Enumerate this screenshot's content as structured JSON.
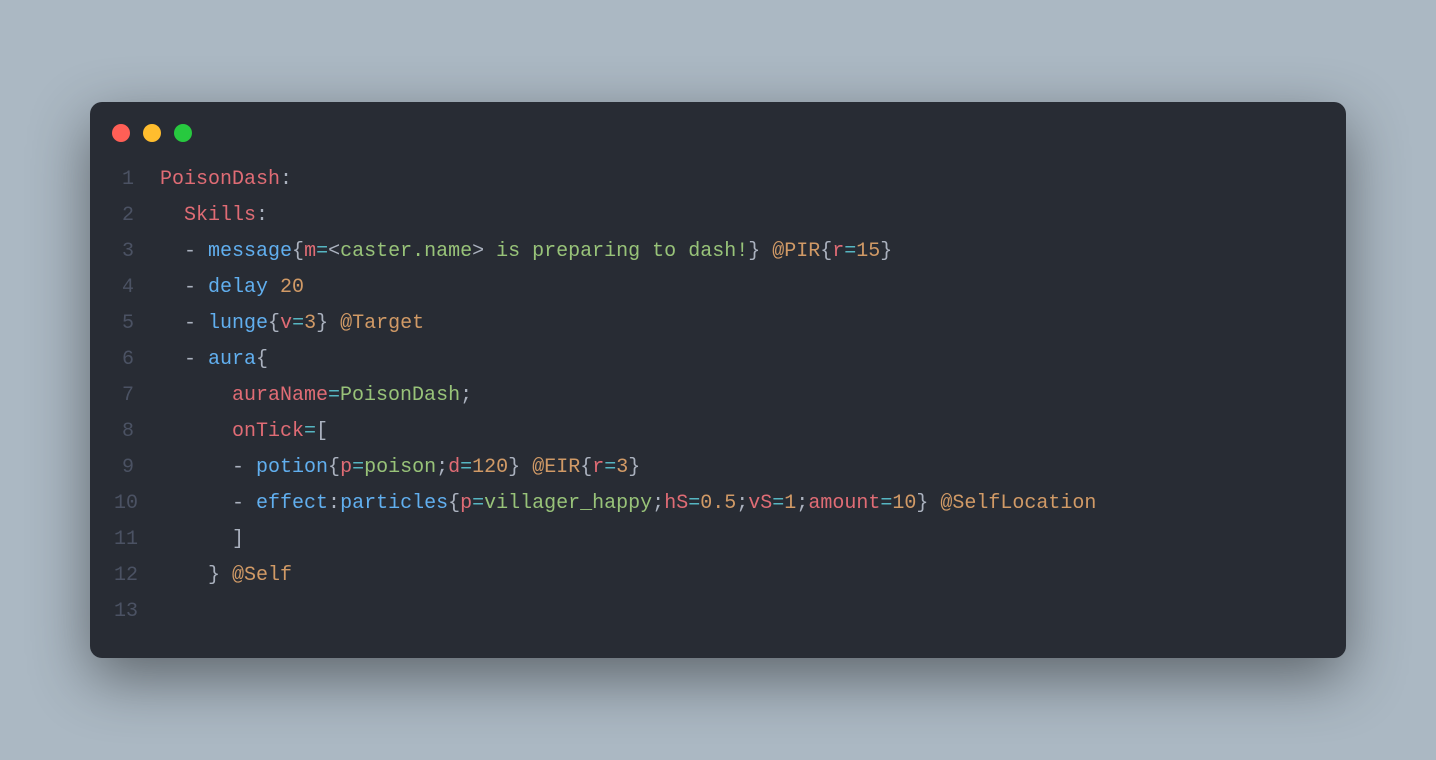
{
  "window": {
    "dots": [
      "red",
      "yellow",
      "green"
    ]
  },
  "code": {
    "lines": [
      {
        "n": "1",
        "tokens": [
          {
            "c": "tk-key",
            "t": "PoisonDash"
          },
          {
            "c": "tk-punc",
            "t": ":"
          }
        ]
      },
      {
        "n": "2",
        "tokens": [
          {
            "c": "tk-default",
            "t": "  "
          },
          {
            "c": "tk-key",
            "t": "Skills"
          },
          {
            "c": "tk-punc",
            "t": ":"
          }
        ]
      },
      {
        "n": "3",
        "tokens": [
          {
            "c": "tk-default",
            "t": "  "
          },
          {
            "c": "tk-punc",
            "t": "- "
          },
          {
            "c": "tk-blue",
            "t": "message"
          },
          {
            "c": "tk-punc",
            "t": "{"
          },
          {
            "c": "tk-key",
            "t": "m"
          },
          {
            "c": "tk-cyan",
            "t": "="
          },
          {
            "c": "tk-punc",
            "t": "<"
          },
          {
            "c": "tk-green",
            "t": "caster.name"
          },
          {
            "c": "tk-punc",
            "t": ">"
          },
          {
            "c": "tk-green",
            "t": " is preparing to dash!"
          },
          {
            "c": "tk-punc",
            "t": "} "
          },
          {
            "c": "tk-orange",
            "t": "@PIR"
          },
          {
            "c": "tk-punc",
            "t": "{"
          },
          {
            "c": "tk-key",
            "t": "r"
          },
          {
            "c": "tk-cyan",
            "t": "="
          },
          {
            "c": "tk-orange",
            "t": "15"
          },
          {
            "c": "tk-punc",
            "t": "}"
          }
        ]
      },
      {
        "n": "4",
        "tokens": [
          {
            "c": "tk-default",
            "t": "  "
          },
          {
            "c": "tk-punc",
            "t": "- "
          },
          {
            "c": "tk-blue",
            "t": "delay "
          },
          {
            "c": "tk-orange",
            "t": "20"
          }
        ]
      },
      {
        "n": "5",
        "tokens": [
          {
            "c": "tk-default",
            "t": "  "
          },
          {
            "c": "tk-punc",
            "t": "- "
          },
          {
            "c": "tk-blue",
            "t": "lunge"
          },
          {
            "c": "tk-punc",
            "t": "{"
          },
          {
            "c": "tk-key",
            "t": "v"
          },
          {
            "c": "tk-cyan",
            "t": "="
          },
          {
            "c": "tk-orange",
            "t": "3"
          },
          {
            "c": "tk-punc",
            "t": "} "
          },
          {
            "c": "tk-orange",
            "t": "@Target"
          }
        ]
      },
      {
        "n": "6",
        "tokens": [
          {
            "c": "tk-default",
            "t": "  "
          },
          {
            "c": "tk-punc",
            "t": "- "
          },
          {
            "c": "tk-blue",
            "t": "aura"
          },
          {
            "c": "tk-punc",
            "t": "{"
          }
        ]
      },
      {
        "n": "7",
        "tokens": [
          {
            "c": "tk-default",
            "t": "      "
          },
          {
            "c": "tk-key",
            "t": "auraName"
          },
          {
            "c": "tk-cyan",
            "t": "="
          },
          {
            "c": "tk-green",
            "t": "PoisonDash"
          },
          {
            "c": "tk-punc",
            "t": ";"
          }
        ]
      },
      {
        "n": "8",
        "tokens": [
          {
            "c": "tk-default",
            "t": "      "
          },
          {
            "c": "tk-key",
            "t": "onTick"
          },
          {
            "c": "tk-cyan",
            "t": "="
          },
          {
            "c": "tk-punc",
            "t": "["
          }
        ]
      },
      {
        "n": "9",
        "tokens": [
          {
            "c": "tk-default",
            "t": "      "
          },
          {
            "c": "tk-punc",
            "t": "- "
          },
          {
            "c": "tk-blue",
            "t": "potion"
          },
          {
            "c": "tk-punc",
            "t": "{"
          },
          {
            "c": "tk-key",
            "t": "p"
          },
          {
            "c": "tk-cyan",
            "t": "="
          },
          {
            "c": "tk-green",
            "t": "poison"
          },
          {
            "c": "tk-punc",
            "t": ";"
          },
          {
            "c": "tk-key",
            "t": "d"
          },
          {
            "c": "tk-cyan",
            "t": "="
          },
          {
            "c": "tk-orange",
            "t": "120"
          },
          {
            "c": "tk-punc",
            "t": "} "
          },
          {
            "c": "tk-orange",
            "t": "@EIR"
          },
          {
            "c": "tk-punc",
            "t": "{"
          },
          {
            "c": "tk-key",
            "t": "r"
          },
          {
            "c": "tk-cyan",
            "t": "="
          },
          {
            "c": "tk-orange",
            "t": "3"
          },
          {
            "c": "tk-punc",
            "t": "}"
          }
        ]
      },
      {
        "n": "10",
        "tokens": [
          {
            "c": "tk-default",
            "t": "      "
          },
          {
            "c": "tk-punc",
            "t": "- "
          },
          {
            "c": "tk-blue",
            "t": "effect"
          },
          {
            "c": "tk-punc",
            "t": ":"
          },
          {
            "c": "tk-blue",
            "t": "particles"
          },
          {
            "c": "tk-punc",
            "t": "{"
          },
          {
            "c": "tk-key",
            "t": "p"
          },
          {
            "c": "tk-cyan",
            "t": "="
          },
          {
            "c": "tk-green",
            "t": "villager_happy"
          },
          {
            "c": "tk-punc",
            "t": ";"
          },
          {
            "c": "tk-key",
            "t": "hS"
          },
          {
            "c": "tk-cyan",
            "t": "="
          },
          {
            "c": "tk-orange",
            "t": "0.5"
          },
          {
            "c": "tk-punc",
            "t": ";"
          },
          {
            "c": "tk-key",
            "t": "vS"
          },
          {
            "c": "tk-cyan",
            "t": "="
          },
          {
            "c": "tk-orange",
            "t": "1"
          },
          {
            "c": "tk-punc",
            "t": ";"
          },
          {
            "c": "tk-key",
            "t": "amount"
          },
          {
            "c": "tk-cyan",
            "t": "="
          },
          {
            "c": "tk-orange",
            "t": "10"
          },
          {
            "c": "tk-punc",
            "t": "} "
          },
          {
            "c": "tk-orange",
            "t": "@SelfLocation"
          }
        ]
      },
      {
        "n": "11",
        "tokens": [
          {
            "c": "tk-default",
            "t": "      "
          },
          {
            "c": "tk-punc",
            "t": "]"
          }
        ]
      },
      {
        "n": "12",
        "tokens": [
          {
            "c": "tk-default",
            "t": "    "
          },
          {
            "c": "tk-punc",
            "t": "} "
          },
          {
            "c": "tk-orange",
            "t": "@Self"
          }
        ]
      },
      {
        "n": "13",
        "tokens": [
          {
            "c": "tk-default",
            "t": ""
          }
        ]
      }
    ]
  }
}
